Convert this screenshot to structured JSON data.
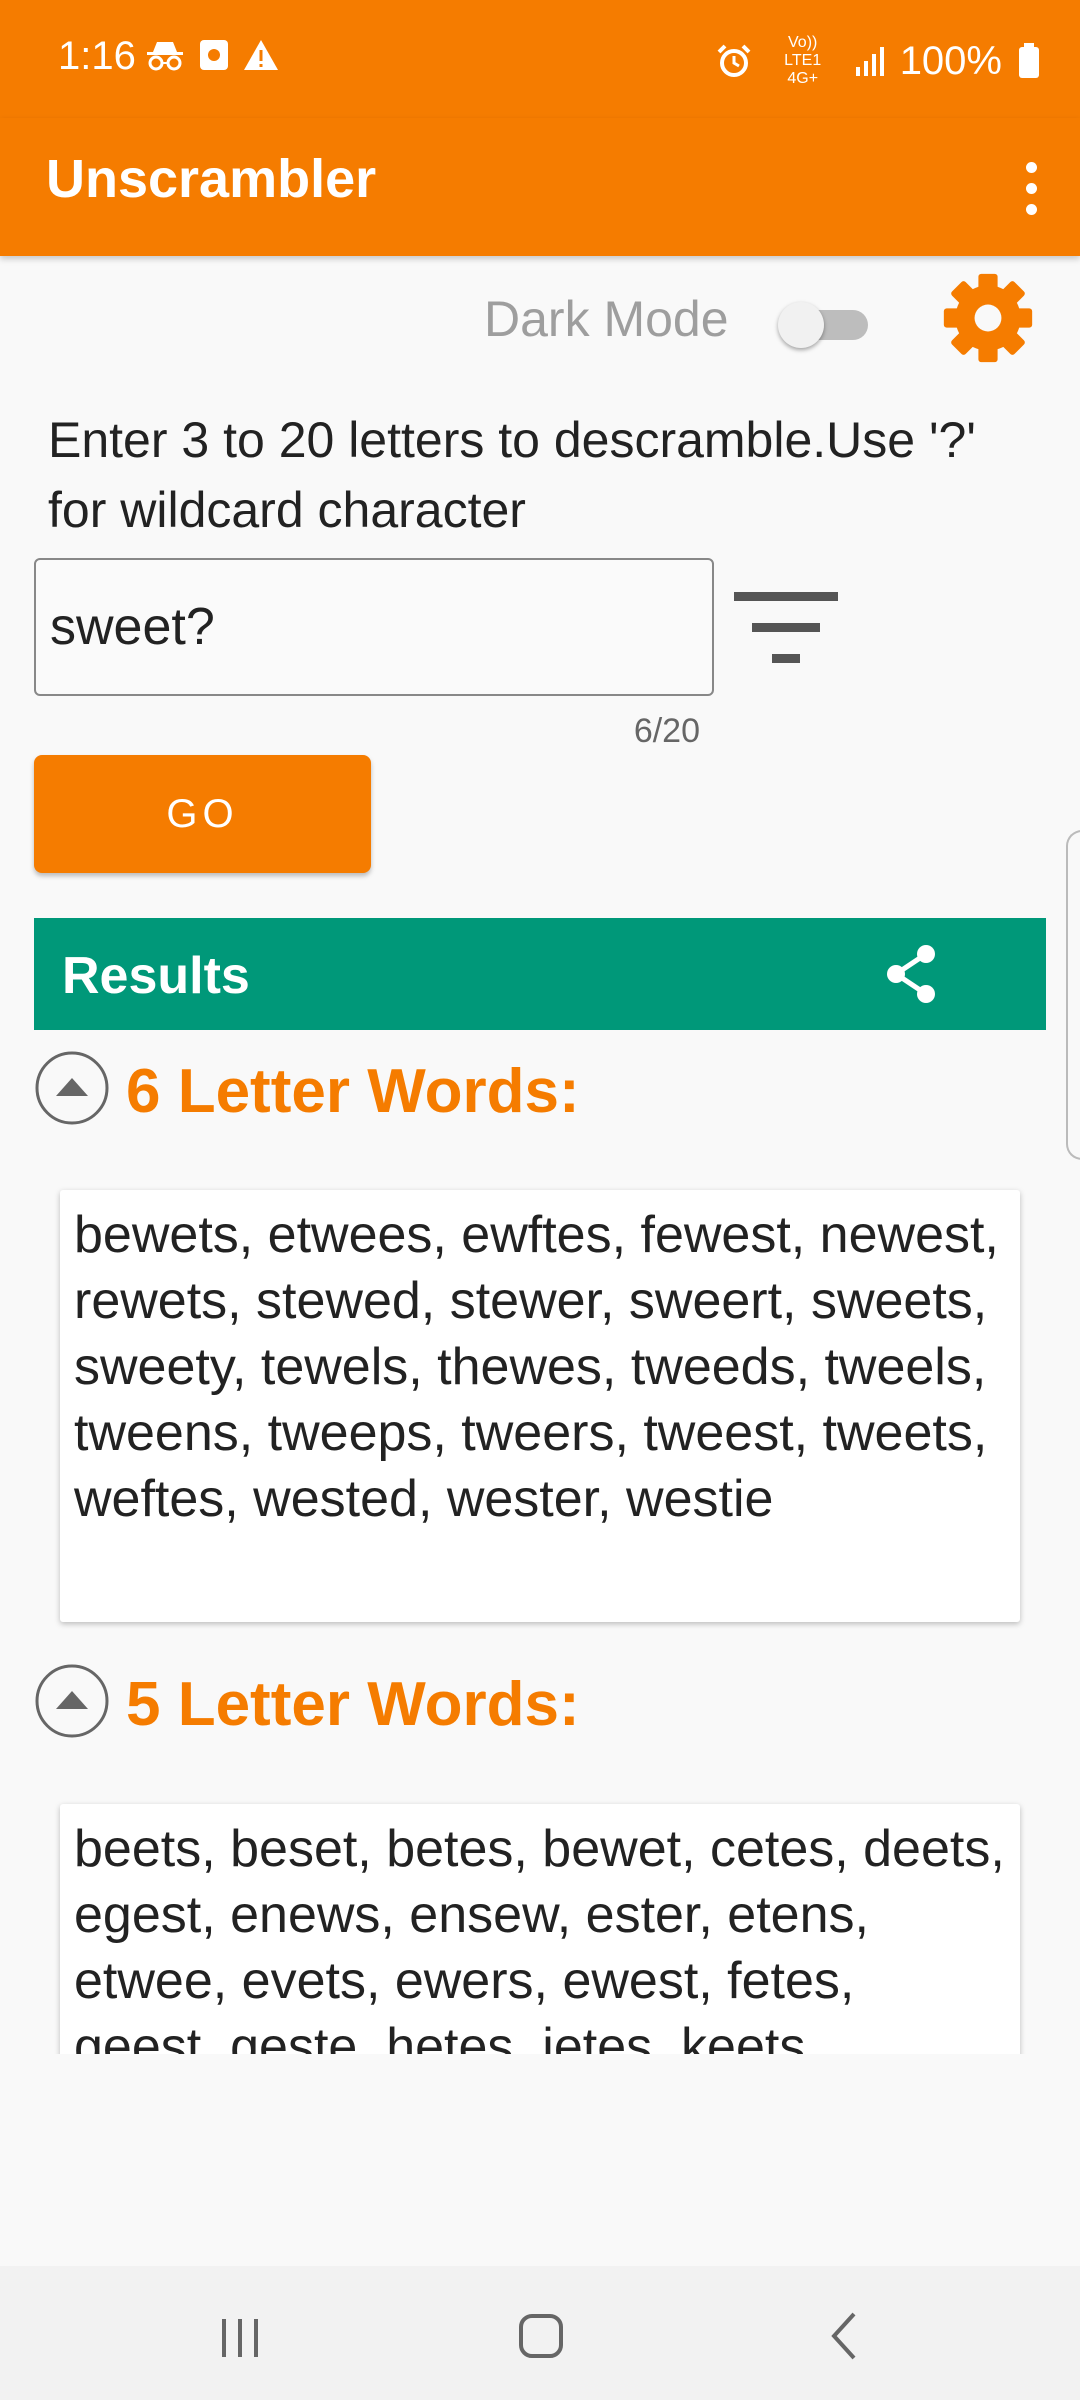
{
  "status_bar": {
    "time": "1:16",
    "network": "Vo)) LTE1 4G+",
    "battery": "100%"
  },
  "app_bar": {
    "title": "Unscrambler"
  },
  "dark_mode": {
    "label": "Dark Mode",
    "enabled": false
  },
  "instructions": "Enter 3 to 20 letters to descramble.Use '?' for wildcard character",
  "input": {
    "value": "sweet?",
    "counter": "6/20"
  },
  "go_label": "GO",
  "results": {
    "title": "Results"
  },
  "sections": [
    {
      "title": "6 Letter Words:",
      "words": "bewets, etwees, ewftes, fewest, newest, rewets, stewed, stewer, sweert, sweets, sweety, tewels, thewes, tweeds, tweels, tweens, tweeps, tweers, tweest, tweets, weftes, wested, wester, westie"
    },
    {
      "title": "5 Letter Words:",
      "words": "beets, beset, betes, bewet, cetes, deets, egest, enews, ensew, ester, etens, etwee, evets, ewers, ewest, fetes, geest, geste, hetes, ietes, keets"
    }
  ],
  "colors": {
    "primary": "#f57c00",
    "results": "#009879"
  },
  "icons": [
    "incognito-icon",
    "gallery-icon",
    "warning-icon",
    "alarm-icon",
    "signal-icon",
    "battery-icon",
    "overflow-menu-icon",
    "gear-icon",
    "filter-icon",
    "share-icon",
    "collapse-icon",
    "recents-icon",
    "home-icon",
    "back-icon"
  ]
}
